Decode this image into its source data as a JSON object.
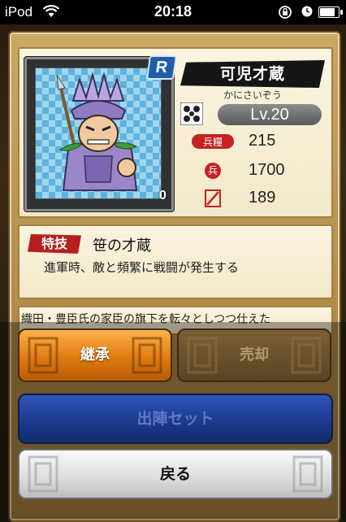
{
  "status_bar": {
    "carrier": "iPod",
    "time": "20:18",
    "battery_level": 0.9
  },
  "general": {
    "name": "可児才蔵",
    "reading": "かにさいぞう",
    "rarity": "R",
    "level": "Lv.20",
    "card_count": "0",
    "stats": [
      {
        "icon": "provisions-icon",
        "value": "215"
      },
      {
        "icon": "soldiers-icon",
        "value": "1700"
      },
      {
        "icon": "weapon-icon",
        "value": "189"
      }
    ]
  },
  "skill": {
    "tag": "特技",
    "name": "笹の才蔵",
    "description": "進軍時、敵と頻繁に戦闘が発生する"
  },
  "bio": {
    "text": "織田・豊臣氏の家臣の旗下を転々としつつ仕えた"
  },
  "buttons": {
    "inherit": "継承",
    "sell": "売却",
    "deploy_set": "出陣セット",
    "back": "戻る"
  },
  "colors": {
    "inherit_button": "#e07a10",
    "deploy_button": "#1c3a8e",
    "skill_tag": "#b71e1e",
    "parchment": "#f3e8c9"
  }
}
